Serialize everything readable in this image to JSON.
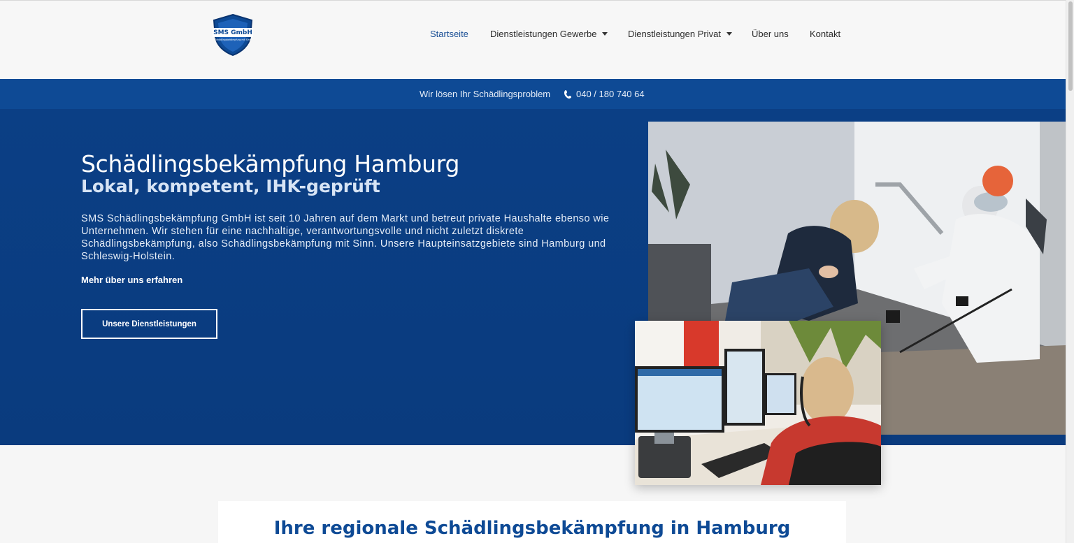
{
  "header": {
    "logo_text": "SMS GmbH",
    "logo_subtext": "Schädlingsbekämpfung mit Sinn",
    "nav": [
      {
        "label": "Startseite",
        "active": true,
        "dropdown": false
      },
      {
        "label": "Dienstleistungen Gewerbe",
        "active": false,
        "dropdown": true
      },
      {
        "label": "Dienstleistungen Privat",
        "active": false,
        "dropdown": true
      },
      {
        "label": "Über uns",
        "active": false,
        "dropdown": false
      },
      {
        "label": "Kontakt",
        "active": false,
        "dropdown": false
      }
    ]
  },
  "topbar": {
    "tagline": "Wir lösen Ihr Schädlingsproblem",
    "phone": "040 / 180 740 64",
    "phone_icon": "phone-icon"
  },
  "hero": {
    "title": "Schädlingsbekämpfung Hamburg",
    "subtitle": "Lokal, kompetent, IHK-geprüft",
    "text": "SMS Schädlingsbekämpfung GmbH ist seit 10 Jahren auf dem Markt und betreut private Haushalte ebenso wie Unternehmen. Wir stehen für eine nachhaltige, verantwortungsvolle und nicht zuletzt diskrete Schädlingsbekämpfung, also Schädlingsbekämpfung mit Sinn. Unsere Haupteinsatzgebiete sind Hamburg und Schleswig-Holstein.",
    "link": "Mehr über uns erfahren",
    "button": "Unsere Dienstleistungen"
  },
  "section": {
    "title": "Ihre regionale Schädlingsbekämpfung in Hamburg"
  },
  "colors": {
    "brand_blue": "#0e4a95",
    "hero_blue": "#0b3f85",
    "active_nav": "#1a4f95"
  }
}
